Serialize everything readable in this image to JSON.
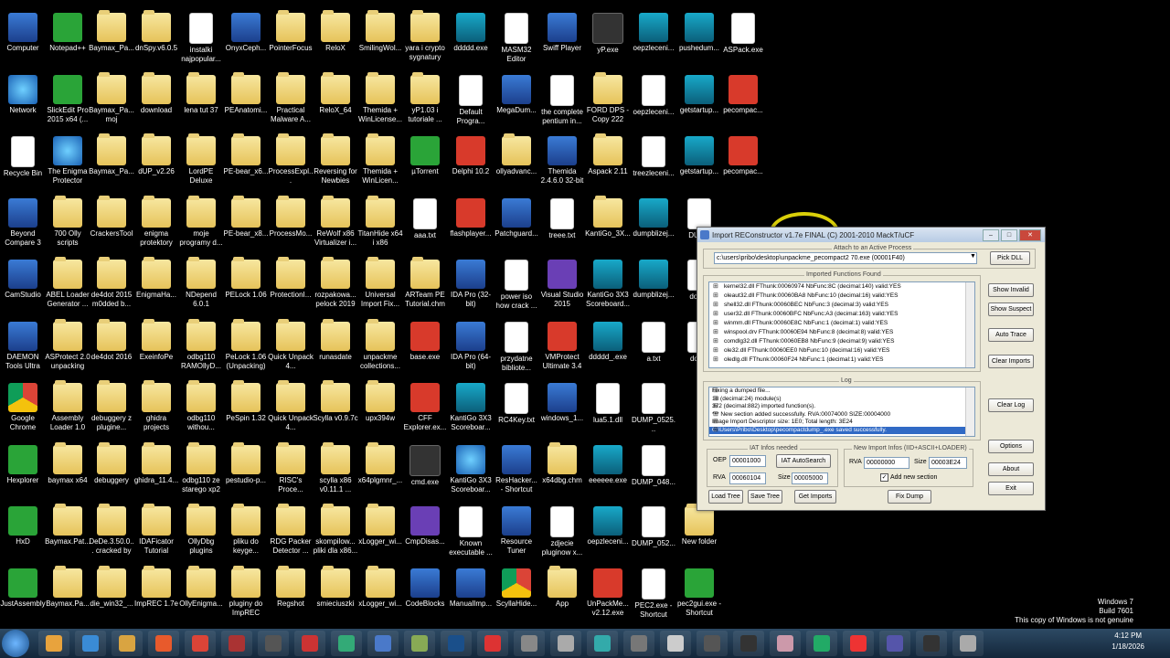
{
  "desktop": {
    "icons": [
      {
        "label": "Computer",
        "kind": "app"
      },
      {
        "label": "Notepad++",
        "kind": "green"
      },
      {
        "label": "Baymax_Pa...",
        "kind": "folder"
      },
      {
        "label": "dnSpy.v6.0.5",
        "kind": "folder"
      },
      {
        "label": "instalki najpopular...",
        "kind": "doc"
      },
      {
        "label": "OnyxCeph...",
        "kind": "app"
      },
      {
        "label": "PointerFocus",
        "kind": "folder"
      },
      {
        "label": "ReloX",
        "kind": "folder"
      },
      {
        "label": "SmilingWol...",
        "kind": "folder"
      },
      {
        "label": "yara i crypto sygnatury",
        "kind": "folder"
      },
      {
        "label": "ddddd.exe",
        "kind": "k3"
      },
      {
        "label": "MASM32 Editor",
        "kind": "doc"
      },
      {
        "label": "Swiff Player",
        "kind": "app"
      },
      {
        "label": "yP.exe",
        "kind": "dark"
      },
      {
        "label": "oepzleceni...",
        "kind": "k3"
      },
      {
        "label": "pushedum...",
        "kind": "k3"
      },
      {
        "label": "ASPack.exe",
        "kind": "doc"
      },
      {
        "label": "Network",
        "kind": "globe"
      },
      {
        "label": "SlickEdit Pro 2015 x64 (...",
        "kind": "green"
      },
      {
        "label": "Baymax_Pa... moj",
        "kind": "folder"
      },
      {
        "label": "download",
        "kind": "folder"
      },
      {
        "label": "lena tut 37",
        "kind": "folder"
      },
      {
        "label": "PEAnatomi...",
        "kind": "folder"
      },
      {
        "label": "Practical Malware A...",
        "kind": "folder"
      },
      {
        "label": "ReloX_64",
        "kind": "folder"
      },
      {
        "label": "Themida + WinLicense...",
        "kind": "folder"
      },
      {
        "label": "yP1.03 i tutoriale ...",
        "kind": "folder"
      },
      {
        "label": "Default Progra...",
        "kind": "doc"
      },
      {
        "label": "MegaDum...",
        "kind": "app"
      },
      {
        "label": "the complete pentium in...",
        "kind": "doc"
      },
      {
        "label": "FORD DPS - Copy 222",
        "kind": "folder"
      },
      {
        "label": "oepzleceni...",
        "kind": "doc"
      },
      {
        "label": "getstartup...",
        "kind": "k3"
      },
      {
        "label": "pecompac...",
        "kind": "red"
      },
      {
        "label": "Recycle Bin",
        "kind": "doc"
      },
      {
        "label": "The Enigma Protector",
        "kind": "globe"
      },
      {
        "label": "Baymax_Pa...",
        "kind": "folder"
      },
      {
        "label": "dUP_v2.26",
        "kind": "folder"
      },
      {
        "label": "LordPE Deluxe",
        "kind": "folder"
      },
      {
        "label": "PE-bear_x6...",
        "kind": "folder"
      },
      {
        "label": "ProcessExpl...",
        "kind": "folder"
      },
      {
        "label": "Reversing for Newbies",
        "kind": "folder"
      },
      {
        "label": "Themida + WinLicen...",
        "kind": "folder"
      },
      {
        "label": "µTorrent",
        "kind": "green"
      },
      {
        "label": "Delphi 10.2",
        "kind": "red"
      },
      {
        "label": "ollyadvanc...",
        "kind": "folder"
      },
      {
        "label": "Themida 2.4.6.0 32-bit",
        "kind": "app"
      },
      {
        "label": "Aspack 2.11",
        "kind": "folder"
      },
      {
        "label": "treezleceni...",
        "kind": "doc"
      },
      {
        "label": "getstartup...",
        "kind": "k3"
      },
      {
        "label": "pecompac...",
        "kind": "red"
      },
      {
        "label": "Beyond Compare 3",
        "kind": "app"
      },
      {
        "label": "700 Olly scripts",
        "kind": "folder"
      },
      {
        "label": "CrackersTool",
        "kind": "folder"
      },
      {
        "label": "enigma protektory",
        "kind": "folder"
      },
      {
        "label": "moje programy d...",
        "kind": "folder"
      },
      {
        "label": "PE-bear_x8...",
        "kind": "folder"
      },
      {
        "label": "ProcessMo...",
        "kind": "folder"
      },
      {
        "label": "ReWolf x86 Virtualizer i...",
        "kind": "folder"
      },
      {
        "label": "TitanHide x64 i x86",
        "kind": "folder"
      },
      {
        "label": "aaa.txt",
        "kind": "doc"
      },
      {
        "label": "flashplayer...",
        "kind": "red"
      },
      {
        "label": "Patchguard...",
        "kind": "app"
      },
      {
        "label": "treee.txt",
        "kind": "doc"
      },
      {
        "label": "KantiGo_3X...",
        "kind": "folder"
      },
      {
        "label": "dumpblizej...",
        "kind": "k3"
      },
      {
        "label": "DUMP",
        "kind": "doc"
      },
      {
        "label": "CamStudio",
        "kind": "app"
      },
      {
        "label": "ABEL Loader Generator ...",
        "kind": "folder"
      },
      {
        "label": "de4dot 2015 m0dded b...",
        "kind": "folder"
      },
      {
        "label": "EnigmaHa...",
        "kind": "folder"
      },
      {
        "label": "NDepend 6.0.1",
        "kind": "folder"
      },
      {
        "label": "PELock 1.06",
        "kind": "folder"
      },
      {
        "label": "ProtectionI...",
        "kind": "folder"
      },
      {
        "label": "rozpakowa... pelock 2019",
        "kind": "folder"
      },
      {
        "label": "Universal Import Fix...",
        "kind": "folder"
      },
      {
        "label": "ARTeam PE Tutorial.chm",
        "kind": "folder"
      },
      {
        "label": "IDA Pro (32-bit)",
        "kind": "app"
      },
      {
        "label": "power iso how crack ...",
        "kind": "doc"
      },
      {
        "label": "Visual Studio 2015",
        "kind": "purple"
      },
      {
        "label": "KantiGo 3X3 Scoreboard...",
        "kind": "k3"
      },
      {
        "label": "dumpblizej...",
        "kind": "k3"
      },
      {
        "label": "dotNe",
        "kind": "doc"
      },
      {
        "label": "DAEMON Tools Ultra",
        "kind": "app"
      },
      {
        "label": "ASProtect 2.0 unpacking",
        "kind": "folder"
      },
      {
        "label": "de4dot 2016",
        "kind": "folder"
      },
      {
        "label": "ExeinfoPe",
        "kind": "folder"
      },
      {
        "label": "odbg110 RAMOllyD...",
        "kind": "folder"
      },
      {
        "label": "PeLock 1.06 (Unpacking)",
        "kind": "folder"
      },
      {
        "label": "Quick Unpack 4...",
        "kind": "folder"
      },
      {
        "label": "runasdate",
        "kind": "folder"
      },
      {
        "label": "unpackme collections...",
        "kind": "folder"
      },
      {
        "label": "base.exe",
        "kind": "red"
      },
      {
        "label": "IDA Pro (64-bit)",
        "kind": "app"
      },
      {
        "label": "przydatne bibliote...",
        "kind": "doc"
      },
      {
        "label": "VMProtect Ultimate 3.4",
        "kind": "red"
      },
      {
        "label": "ddddd_.exe",
        "kind": "k3"
      },
      {
        "label": "a.txt",
        "kind": "doc"
      },
      {
        "label": "dotne",
        "kind": "doc"
      },
      {
        "label": "Google Chrome",
        "kind": "chrome"
      },
      {
        "label": "Assembly Loader 1.0",
        "kind": "folder"
      },
      {
        "label": "debuggery z plugine...",
        "kind": "folder"
      },
      {
        "label": "ghidra projects",
        "kind": "folder"
      },
      {
        "label": "odbg110 withou...",
        "kind": "folder"
      },
      {
        "label": "PeSpin 1.32",
        "kind": "folder"
      },
      {
        "label": "Quick Unpack 4...",
        "kind": "folder"
      },
      {
        "label": "Scylla v0.9.7c",
        "kind": "folder"
      },
      {
        "label": "upx394w",
        "kind": "folder"
      },
      {
        "label": "CFF Explorer.ex...",
        "kind": "red"
      },
      {
        "label": "KantiGo 3X3 Scoreboar...",
        "kind": "k3"
      },
      {
        "label": "RC4Key.txt",
        "kind": "doc"
      },
      {
        "label": "windows_1...",
        "kind": "app"
      },
      {
        "label": "lua5.1.dll",
        "kind": "doc"
      },
      {
        "label": "DUMP_0525...",
        "kind": "doc"
      },
      {
        "label": "Hexplorer",
        "kind": "green"
      },
      {
        "label": "baymax x64",
        "kind": "folder"
      },
      {
        "label": "debuggery",
        "kind": "folder"
      },
      {
        "label": "ghidra_11.4...",
        "kind": "folder"
      },
      {
        "label": "odbg110 ze starego xp2",
        "kind": "folder"
      },
      {
        "label": "pestudio-p...",
        "kind": "folder"
      },
      {
        "label": "RISC's Proce...",
        "kind": "folder"
      },
      {
        "label": "scylla x86 v0.11.1 ...",
        "kind": "folder"
      },
      {
        "label": "x64plgmnr_...",
        "kind": "folder"
      },
      {
        "label": "cmd.exe",
        "kind": "dark"
      },
      {
        "label": "KantiGo 3X3 Scoreboar...",
        "kind": "globe"
      },
      {
        "label": "ResHacker... - Shortcut",
        "kind": "app"
      },
      {
        "label": "x64dbg.chm",
        "kind": "folder"
      },
      {
        "label": "eeeeee.exe",
        "kind": "k3"
      },
      {
        "label": "DUMP_048...",
        "kind": "doc"
      },
      {
        "label": "HxD",
        "kind": "green"
      },
      {
        "label": "Baymax.Pat...",
        "kind": "folder"
      },
      {
        "label": "DeDe.3.50.0... cracked by ...",
        "kind": "folder"
      },
      {
        "label": "IDAFicator Tutorial",
        "kind": "folder"
      },
      {
        "label": "OllyDbg plugins",
        "kind": "folder"
      },
      {
        "label": "pliku do keyge...",
        "kind": "folder"
      },
      {
        "label": "RDG Packer Detector ...",
        "kind": "folder"
      },
      {
        "label": "skompilow... pliki dla x86...",
        "kind": "folder"
      },
      {
        "label": "xLogger_wi...",
        "kind": "folder"
      },
      {
        "label": "CmpDisas...",
        "kind": "purple"
      },
      {
        "label": "Known executable ...",
        "kind": "doc"
      },
      {
        "label": "Resource Tuner",
        "kind": "app"
      },
      {
        "label": "zdjecie pluginow x...",
        "kind": "doc"
      },
      {
        "label": "oepzleceni...",
        "kind": "k3"
      },
      {
        "label": "DUMP_052...",
        "kind": "doc"
      },
      {
        "label": "New folder",
        "kind": "folder"
      },
      {
        "label": "JustAssembly",
        "kind": "green"
      },
      {
        "label": "Baymax.Pa...",
        "kind": "folder"
      },
      {
        "label": "die_win32_...",
        "kind": "folder"
      },
      {
        "label": "ImpREC 1.7e",
        "kind": "folder"
      },
      {
        "label": "OllyEnigma...",
        "kind": "folder"
      },
      {
        "label": "pluginy do ImpREC",
        "kind": "folder"
      },
      {
        "label": "Regshot",
        "kind": "folder"
      },
      {
        "label": "smieciuszki",
        "kind": "folder"
      },
      {
        "label": "xLogger_wi...",
        "kind": "folder"
      },
      {
        "label": "CodeBlocks",
        "kind": "app"
      },
      {
        "label": "ManualImp...",
        "kind": "app"
      },
      {
        "label": "ScyllaHide...",
        "kind": "chrome"
      },
      {
        "label": "App",
        "kind": "folder"
      },
      {
        "label": "UnPackMe... v2.12.exe",
        "kind": "red"
      },
      {
        "label": "PEC2.exe - Shortcut",
        "kind": "doc"
      },
      {
        "label": "pec2gui.exe - Shortcut",
        "kind": "green"
      }
    ]
  },
  "window": {
    "title": "Import REConstructor v1.7e FINAL (C) 2001-2010 MackT/uCF",
    "attach_label": "Attach to an Active Process",
    "process_path": "c:\\users\\pribo\\desktop\\unpackme_pecompact2 70.exe (00001F40)",
    "pick_dll": "Pick DLL",
    "imported_label": "Imported Functions Found",
    "imports": [
      "kernel32.dll FThunk:00060974 NbFunc:8C (decimal:140) valid:YES",
      "oleaut32.dll FThunk:00060BA8 NbFunc:10 (decimal:16) valid:YES",
      "shell32.dll FThunk:00060BEC NbFunc:3 (decimal:3) valid:YES",
      "user32.dll FThunk:00060BFC NbFunc:A3 (decimal:163) valid:YES",
      "winmm.dll FThunk:00060E8C NbFunc:1 (decimal:1) valid:YES",
      "winspool.drv FThunk:00060E94 NbFunc:8 (decimal:8) valid:YES",
      "comdlg32.dll FThunk:00060EB8 NbFunc:9 (decimal:9) valid:YES",
      "ole32.dll FThunk:00060EE0 NbFunc:10 (decimal:16) valid:YES",
      "oledlg.dll FThunk:00060F24 NbFunc:1 (decimal:1) valid:YES"
    ],
    "show_invalid": "Show Invalid",
    "show_suspect": "Show Suspect",
    "auto_trace": "Auto Trace",
    "clear_imports": "Clear Imports",
    "log_label": "Log",
    "log_lines": [
      "Fixing a dumped file...",
      "18 (decimal:24) module(s)",
      "372 (decimal:882) imported function(s).",
      "*** New section added successfully. RVA:00074000 SIZE:00004000",
      "Image Import Descriptor size: 1E0; Total length: 3E24",
      "C:\\Users\\Pribo\\Desktop\\pecompactdump_.exe saved successfully."
    ],
    "clear_log": "Clear Log",
    "iat_label": "IAT Infos needed",
    "oep_label": "OEP",
    "oep_value": "00001000",
    "iat_autosearch": "IAT AutoSearch",
    "rva_label": "RVA",
    "rva_value": "00060104",
    "size_label": "Size",
    "size_value": "00005000",
    "new_import_label": "New Import Infos (IID+ASCII+LOADER)",
    "new_rva_label": "RVA",
    "new_rva_value": "00000000",
    "new_size_label": "Size",
    "new_size_value": "00003E24",
    "add_new_section": "Add new section",
    "options": "Options",
    "about": "About",
    "exit": "Exit",
    "load_tree": "Load Tree",
    "save_tree": "Save Tree",
    "get_imports": "Get Imports",
    "fix_dump": "Fix Dump"
  },
  "watermark": {
    "line1": "Windows 7",
    "line2": "Build 7601",
    "line3": "This copy of Windows is not genuine"
  },
  "clock": {
    "time": "4:12 PM",
    "date": "1/18/2026"
  },
  "taskbar_colors": [
    "#e8a33d",
    "#3a8bd5",
    "#d9a441",
    "#e85a2c",
    "#db4437",
    "#a33",
    "#555",
    "#c33",
    "#3a7",
    "#4a79c9",
    "#8a5",
    "#1a4f8a",
    "#d33",
    "#888",
    "#aaa",
    "#3aa",
    "#777",
    "#ccc",
    "#555",
    "#333",
    "#c9a",
    "#2a6",
    "#e33",
    "#55a",
    "#333",
    "#aaa"
  ]
}
